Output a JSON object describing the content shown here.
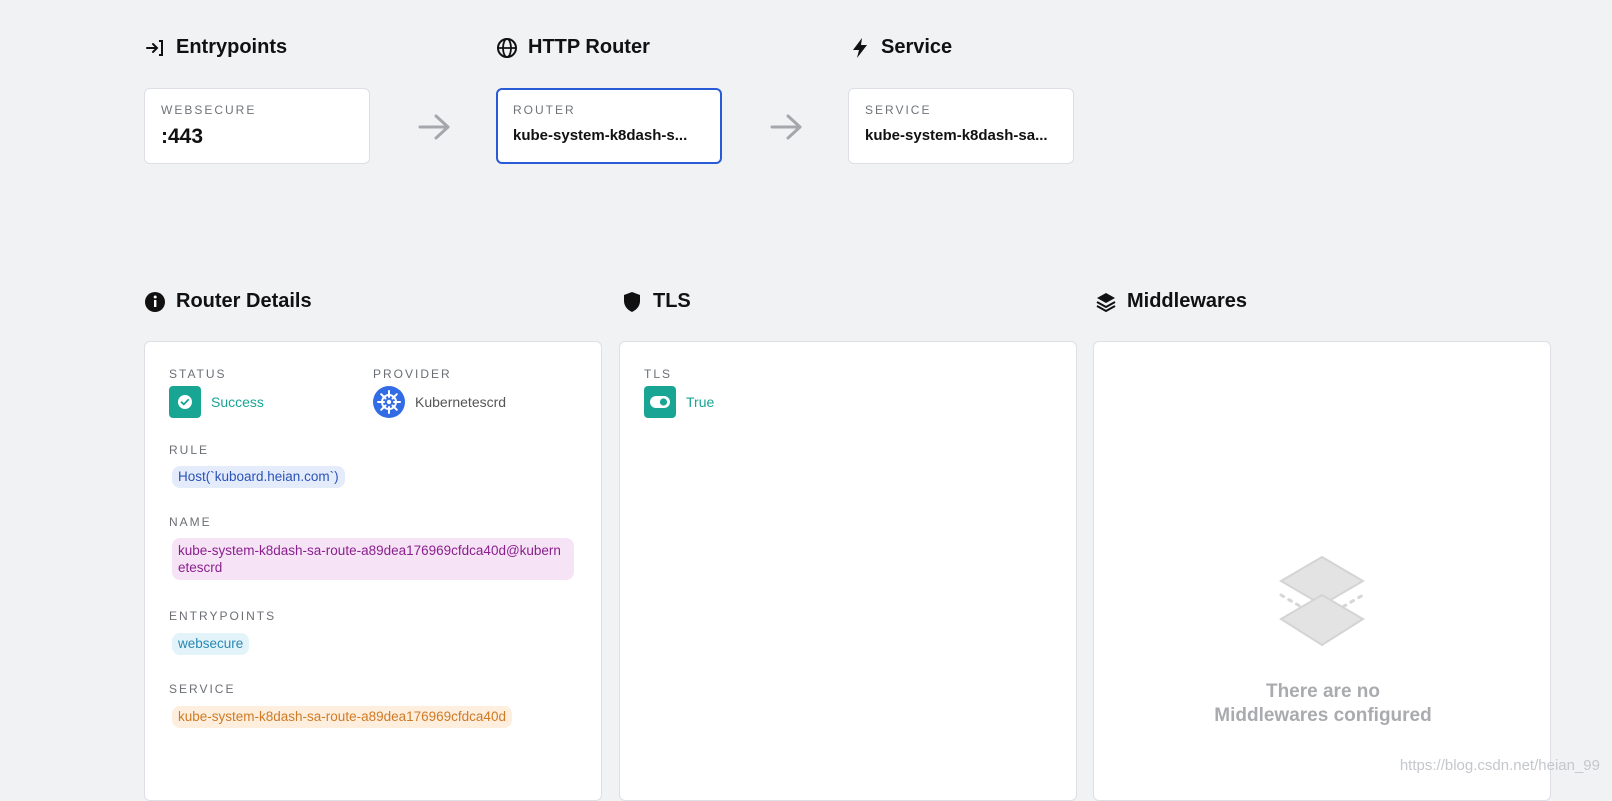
{
  "flow": {
    "entrypoints": {
      "title": "Entrypoints",
      "label": "WEBSECURE",
      "value": ":443"
    },
    "router": {
      "title": "HTTP Router",
      "label": "ROUTER",
      "value": "kube-system-k8dash-s..."
    },
    "service": {
      "title": "Service",
      "label": "SERVICE",
      "value": "kube-system-k8dash-sa..."
    }
  },
  "router_details": {
    "title": "Router Details",
    "status_label": "STATUS",
    "status_value": "Success",
    "provider_label": "PROVIDER",
    "provider_value": "Kubernetescrd",
    "rule_label": "RULE",
    "rule_value": "Host(`kuboard.heian.com`)",
    "name_label": "NAME",
    "name_value": "kube-system-k8dash-sa-route-a89dea176969cfdca40d@kubernetescrd",
    "entrypoints_label": "ENTRYPOINTS",
    "entrypoints_value": "websecure",
    "service_label": "SERVICE",
    "service_value": "kube-system-k8dash-sa-route-a89dea176969cfdca40d"
  },
  "tls": {
    "title": "TLS",
    "label": "TLS",
    "value": "True"
  },
  "middlewares": {
    "title": "Middlewares",
    "empty_line1": "There are no",
    "empty_line2": "Middlewares configured"
  },
  "watermark": "https://blog.csdn.net/heian_99",
  "colors": {
    "accent_blue": "#2a5bd7",
    "success_teal": "#18a594",
    "provider_blue": "#326ce5",
    "rule_chip_bg": "#e4ecfb",
    "name_chip_bg": "#f6e4f6",
    "entry_chip_bg": "#e2f3f9",
    "service_chip_bg": "#fdeedd"
  },
  "icons": {
    "entrypoints": "login-arrow-icon",
    "router": "globe-icon",
    "service": "lightning-icon",
    "router_details": "info-circle-icon",
    "tls": "shield-icon",
    "middlewares": "layers-icon",
    "status": "check-circle-icon",
    "provider": "kubernetes-helm-icon",
    "tls_toggle": "toggle-on-icon",
    "empty_middlewares": "layers-empty-icon"
  }
}
